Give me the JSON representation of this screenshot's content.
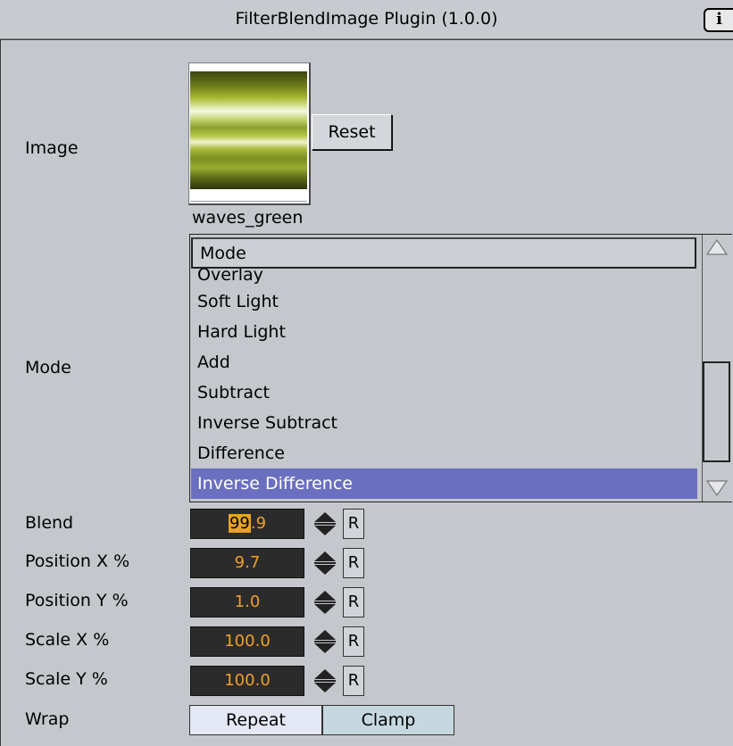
{
  "window": {
    "title": "FilterBlendImage Plugin (1.0.0)",
    "help_icon": "help-icon"
  },
  "image": {
    "label": "Image",
    "file_name": "waves_green",
    "reset_label": "Reset"
  },
  "mode": {
    "label": "Mode",
    "header": "Mode",
    "items": [
      "Overlay",
      "Soft Light",
      "Hard Light",
      "Add",
      "Subtract",
      "Inverse Subtract",
      "Difference",
      "Inverse Difference"
    ],
    "selected": "Inverse Difference"
  },
  "params": {
    "blend": {
      "label": "Blend",
      "value_hl": "99",
      "value_rest": ".9",
      "reset": "R"
    },
    "position_x": {
      "label": "Position X %",
      "value": "9.7",
      "reset": "R"
    },
    "position_y": {
      "label": "Position Y %",
      "value": "1.0",
      "reset": "R"
    },
    "scale_x": {
      "label": "Scale X %",
      "value": "100.0",
      "reset": "R"
    },
    "scale_y": {
      "label": "Scale Y %",
      "value": "100.0",
      "reset": "R"
    }
  },
  "wrap": {
    "label": "Wrap",
    "options": [
      "Repeat",
      "Clamp"
    ],
    "selected": "Repeat"
  },
  "colors": {
    "background": "#c4c7cc",
    "selection": "#6b6fbf",
    "field_bg": "#2b2b2b",
    "field_text": "#f0a02a"
  }
}
